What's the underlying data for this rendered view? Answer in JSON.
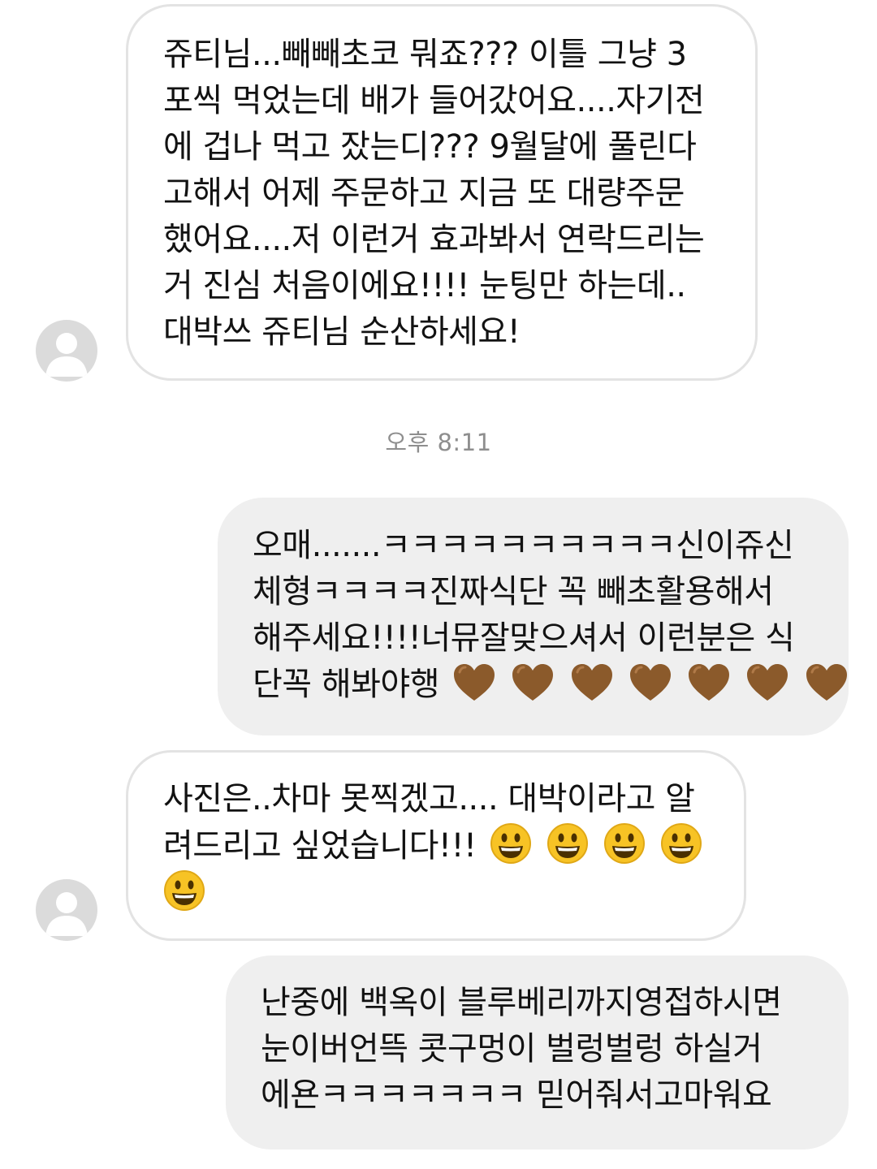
{
  "conversation": {
    "timestamp": "오후 8:11",
    "messages": [
      {
        "direction": "incoming",
        "lines": [
          "쥬티님...빼빼초코 뭐죠??? 이틀 그냥 3",
          "포씩 먹었는데 배가 들어갔어요....자기전",
          "에 겁나 먹고 잤는디??? 9월달에 풀린다",
          "고해서 어제 주문하고 지금 또 대량주문",
          "했어요....저 이런거 효과봐서 연락드리는",
          "거 진심 처음이에요!!!! 눈팅만 하는데..",
          "대박쓰 쥬티님 순산하세요!"
        ]
      },
      {
        "direction": "outgoing",
        "lines": [
          "오매.......ㅋㅋㅋㅋㅋㅋㅋㅋㅋㅋ신이쥬신",
          "체형ㅋㅋㅋㅋ진짜식단 꼭 빼초활용해서",
          "해주세요!!!!너뮤잘맞으셔서 이런분은 식",
          "단꼭 해봐야행"
        ],
        "emoji": "brown-heart",
        "emoji_count": 7
      },
      {
        "direction": "incoming",
        "lines": [
          "사진은..차마 못찍겠고.... 대박이라고 알",
          "려드리고 싶었습니다!!!"
        ],
        "emoji": "grinning-face",
        "emoji_count": 5
      },
      {
        "direction": "outgoing",
        "lines": [
          "난중에 백옥이 블루베리까지영접하시면",
          "눈이버언뜩 콧구멍이 벌렁벌렁 하실거",
          "에욘ㅋㅋㅋㅋㅋㅋㅋ 믿어줘서고마워요"
        ]
      }
    ]
  },
  "colors": {
    "incoming_border": "#e3e3e3",
    "outgoing_background": "#efefef",
    "timestamp_text": "#8e8e8e",
    "avatar_background": "#dbdbdb",
    "heart": "#8b5a2b",
    "smiley": "#f7c325"
  }
}
